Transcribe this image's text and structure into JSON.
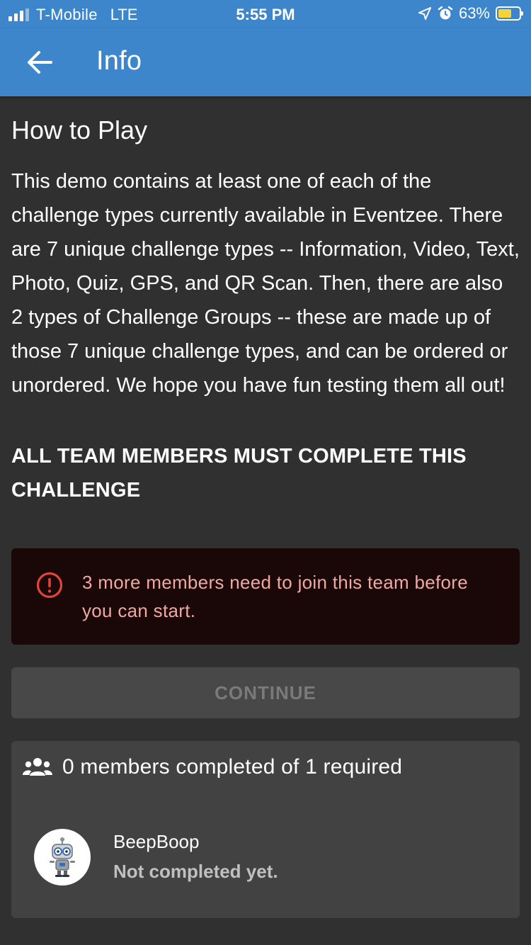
{
  "status_bar": {
    "carrier": "T-Mobile",
    "network": "LTE",
    "time": "5:55 PM",
    "battery_percent": "63%",
    "battery_level": 0.63,
    "icons": [
      "signal-icon",
      "location-arrow-icon",
      "alarm-icon",
      "battery-icon"
    ]
  },
  "app_bar": {
    "back_icon": "arrow-left-icon",
    "title": "Info"
  },
  "content": {
    "heading": "How to Play",
    "body": "This demo contains at least one of each of the challenge types currently available in Eventzee. There are 7 unique challenge types -- Information, Video, Text, Photo, Quiz, GPS, and QR Scan. Then, there are also 2 types of Challenge Groups -- these are made up of those 7 unique challenge types, and can be ordered or unordered. We hope you have fun testing them all out!",
    "requirement": "ALL TEAM MEMBERS MUST COMPLETE THIS CHALLENGE"
  },
  "alert": {
    "icon": "error-circle-icon",
    "message": "3 more members need to join this team before you can start."
  },
  "continue_button": {
    "label": "CONTINUE",
    "enabled": false
  },
  "members": {
    "icon": "group-icon",
    "summary": "0 members completed of 1 required",
    "list": [
      {
        "name": "BeepBoop",
        "status": "Not completed yet.",
        "avatar": "robot-avatar"
      }
    ]
  },
  "colors": {
    "primary": "#3d86cc",
    "background": "#303030",
    "alert_background": "#190807",
    "alert_text": "#f0a8a2",
    "alert_icon": "#e0453b",
    "battery": "#f5d33d"
  }
}
